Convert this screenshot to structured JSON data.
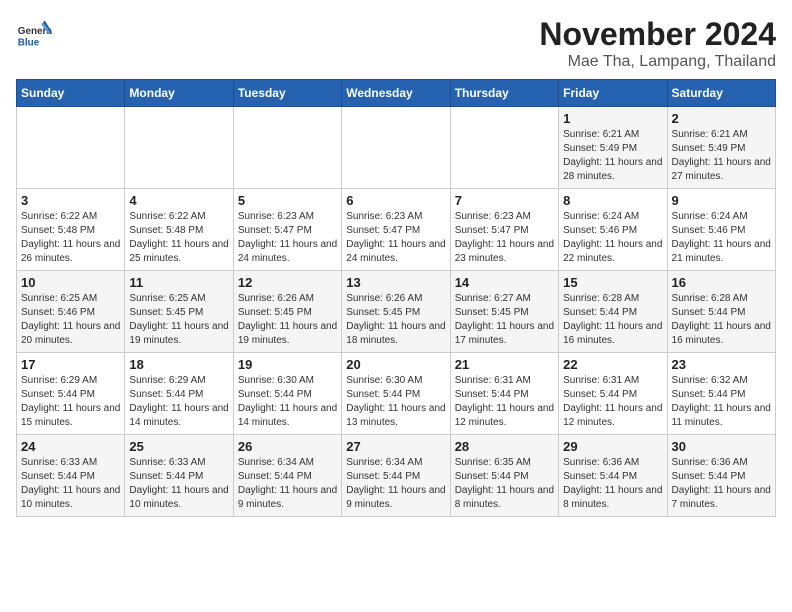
{
  "header": {
    "logo_text_general": "General",
    "logo_text_blue": "Blue",
    "month_title": "November 2024",
    "location": "Mae Tha, Lampang, Thailand"
  },
  "calendar": {
    "weekdays": [
      "Sunday",
      "Monday",
      "Tuesday",
      "Wednesday",
      "Thursday",
      "Friday",
      "Saturday"
    ],
    "weeks": [
      [
        {
          "day": "",
          "info": ""
        },
        {
          "day": "",
          "info": ""
        },
        {
          "day": "",
          "info": ""
        },
        {
          "day": "",
          "info": ""
        },
        {
          "day": "",
          "info": ""
        },
        {
          "day": "1",
          "info": "Sunrise: 6:21 AM\nSunset: 5:49 PM\nDaylight: 11 hours and 28 minutes."
        },
        {
          "day": "2",
          "info": "Sunrise: 6:21 AM\nSunset: 5:49 PM\nDaylight: 11 hours and 27 minutes."
        }
      ],
      [
        {
          "day": "3",
          "info": "Sunrise: 6:22 AM\nSunset: 5:48 PM\nDaylight: 11 hours and 26 minutes."
        },
        {
          "day": "4",
          "info": "Sunrise: 6:22 AM\nSunset: 5:48 PM\nDaylight: 11 hours and 25 minutes."
        },
        {
          "day": "5",
          "info": "Sunrise: 6:23 AM\nSunset: 5:47 PM\nDaylight: 11 hours and 24 minutes."
        },
        {
          "day": "6",
          "info": "Sunrise: 6:23 AM\nSunset: 5:47 PM\nDaylight: 11 hours and 24 minutes."
        },
        {
          "day": "7",
          "info": "Sunrise: 6:23 AM\nSunset: 5:47 PM\nDaylight: 11 hours and 23 minutes."
        },
        {
          "day": "8",
          "info": "Sunrise: 6:24 AM\nSunset: 5:46 PM\nDaylight: 11 hours and 22 minutes."
        },
        {
          "day": "9",
          "info": "Sunrise: 6:24 AM\nSunset: 5:46 PM\nDaylight: 11 hours and 21 minutes."
        }
      ],
      [
        {
          "day": "10",
          "info": "Sunrise: 6:25 AM\nSunset: 5:46 PM\nDaylight: 11 hours and 20 minutes."
        },
        {
          "day": "11",
          "info": "Sunrise: 6:25 AM\nSunset: 5:45 PM\nDaylight: 11 hours and 19 minutes."
        },
        {
          "day": "12",
          "info": "Sunrise: 6:26 AM\nSunset: 5:45 PM\nDaylight: 11 hours and 19 minutes."
        },
        {
          "day": "13",
          "info": "Sunrise: 6:26 AM\nSunset: 5:45 PM\nDaylight: 11 hours and 18 minutes."
        },
        {
          "day": "14",
          "info": "Sunrise: 6:27 AM\nSunset: 5:45 PM\nDaylight: 11 hours and 17 minutes."
        },
        {
          "day": "15",
          "info": "Sunrise: 6:28 AM\nSunset: 5:44 PM\nDaylight: 11 hours and 16 minutes."
        },
        {
          "day": "16",
          "info": "Sunrise: 6:28 AM\nSunset: 5:44 PM\nDaylight: 11 hours and 16 minutes."
        }
      ],
      [
        {
          "day": "17",
          "info": "Sunrise: 6:29 AM\nSunset: 5:44 PM\nDaylight: 11 hours and 15 minutes."
        },
        {
          "day": "18",
          "info": "Sunrise: 6:29 AM\nSunset: 5:44 PM\nDaylight: 11 hours and 14 minutes."
        },
        {
          "day": "19",
          "info": "Sunrise: 6:30 AM\nSunset: 5:44 PM\nDaylight: 11 hours and 14 minutes."
        },
        {
          "day": "20",
          "info": "Sunrise: 6:30 AM\nSunset: 5:44 PM\nDaylight: 11 hours and 13 minutes."
        },
        {
          "day": "21",
          "info": "Sunrise: 6:31 AM\nSunset: 5:44 PM\nDaylight: 11 hours and 12 minutes."
        },
        {
          "day": "22",
          "info": "Sunrise: 6:31 AM\nSunset: 5:44 PM\nDaylight: 11 hours and 12 minutes."
        },
        {
          "day": "23",
          "info": "Sunrise: 6:32 AM\nSunset: 5:44 PM\nDaylight: 11 hours and 11 minutes."
        }
      ],
      [
        {
          "day": "24",
          "info": "Sunrise: 6:33 AM\nSunset: 5:44 PM\nDaylight: 11 hours and 10 minutes."
        },
        {
          "day": "25",
          "info": "Sunrise: 6:33 AM\nSunset: 5:44 PM\nDaylight: 11 hours and 10 minutes."
        },
        {
          "day": "26",
          "info": "Sunrise: 6:34 AM\nSunset: 5:44 PM\nDaylight: 11 hours and 9 minutes."
        },
        {
          "day": "27",
          "info": "Sunrise: 6:34 AM\nSunset: 5:44 PM\nDaylight: 11 hours and 9 minutes."
        },
        {
          "day": "28",
          "info": "Sunrise: 6:35 AM\nSunset: 5:44 PM\nDaylight: 11 hours and 8 minutes."
        },
        {
          "day": "29",
          "info": "Sunrise: 6:36 AM\nSunset: 5:44 PM\nDaylight: 11 hours and 8 minutes."
        },
        {
          "day": "30",
          "info": "Sunrise: 6:36 AM\nSunset: 5:44 PM\nDaylight: 11 hours and 7 minutes."
        }
      ]
    ]
  }
}
